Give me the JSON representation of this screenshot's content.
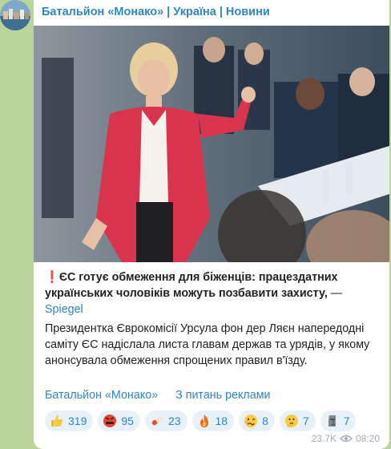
{
  "channel": {
    "title": "Батальйон «Монако» | Україна | Новини"
  },
  "post": {
    "headline_mark": "❗",
    "headline": "ЄС готує обмеження для біженців: працездатних українських чоловіків можуть позбавити захисту,",
    "headline_dash": " — ",
    "source": "Spiegel",
    "body": "Президентка Єврокомісії Урсула фон дер Ляєн напередодні саміту ЄС надіслала листа главам держав та урядів, у якому анонсувала обмеження спрощених правил в'їзду.",
    "channel_link": "Батальйон «Монако»",
    "ads_link": "З питань реклами"
  },
  "reactions": [
    {
      "icon": "thumbs-up-icon",
      "count": "319"
    },
    {
      "icon": "angry-face-icon",
      "count": "95"
    },
    {
      "icon": "pill-icon",
      "count": "23"
    },
    {
      "icon": "fire-icon",
      "count": "18"
    },
    {
      "icon": "woozy-face-icon",
      "count": "8"
    },
    {
      "icon": "thinking-face-icon",
      "count": "7"
    },
    {
      "icon": "moai-icon",
      "count": "7"
    }
  ],
  "meta": {
    "views": "23.7K",
    "time": "08:20"
  },
  "colors": {
    "link": "#2f86c4",
    "background": "#b9d59c",
    "reaction_bg": "#e7f1fa"
  }
}
